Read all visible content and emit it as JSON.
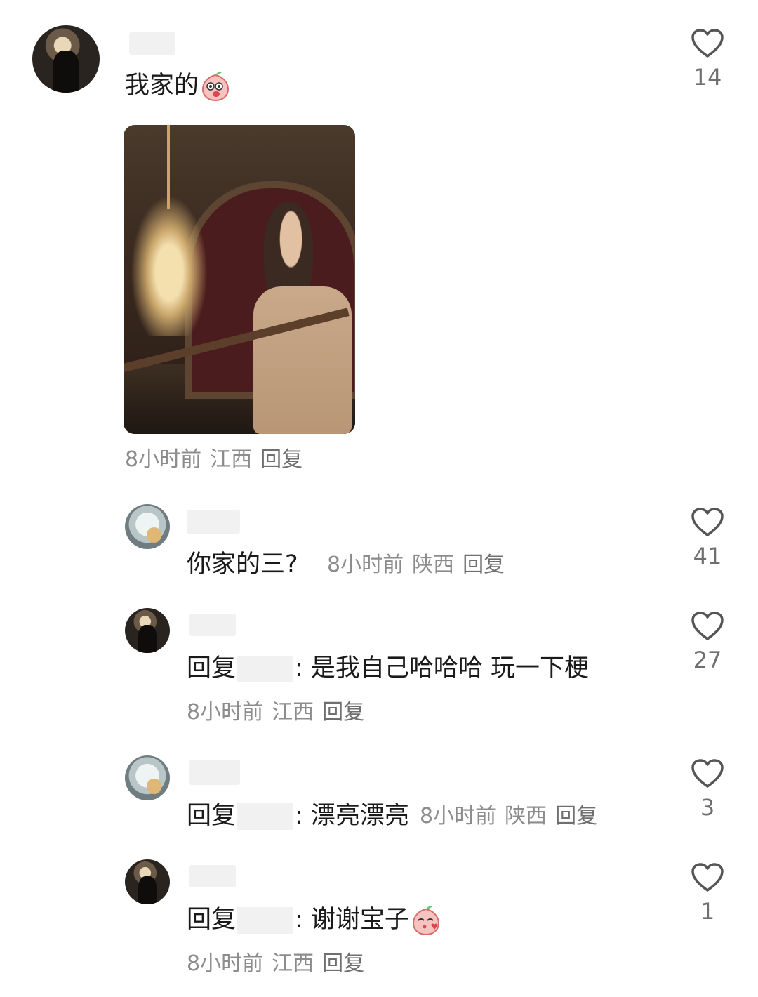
{
  "comments": [
    {
      "text": "我家的",
      "emoji": "peach-laughing-emoji",
      "likes": "14",
      "meta": {
        "time": "8小时前",
        "location": "江西",
        "reply": "回复"
      },
      "has_image": true
    }
  ],
  "replies": [
    {
      "text": "你家的三?",
      "likes": "41",
      "meta": {
        "time": "8小时前",
        "location": "陕西",
        "reply": "回复"
      }
    },
    {
      "prefix": "回复",
      "text": ": 是我自己哈哈哈 玩一下梗",
      "likes": "27",
      "meta": {
        "time": "8小时前",
        "location": "江西",
        "reply": "回复"
      }
    },
    {
      "prefix": "回复",
      "text": ": 漂亮漂亮",
      "likes": "3",
      "meta": {
        "time": "8小时前",
        "location": "陕西",
        "reply": "回复"
      }
    },
    {
      "prefix": "回复",
      "text": ": 谢谢宝子",
      "emoji": "peach-blowing-kiss-emoji",
      "likes": "1",
      "meta": {
        "time": "8小时前",
        "location": "江西",
        "reply": "回复"
      }
    }
  ],
  "colors": {
    "text": "#1a1a1a",
    "meta": "#8c8c8c",
    "like_icon": "#555555",
    "blur": "#f1f1f1"
  }
}
